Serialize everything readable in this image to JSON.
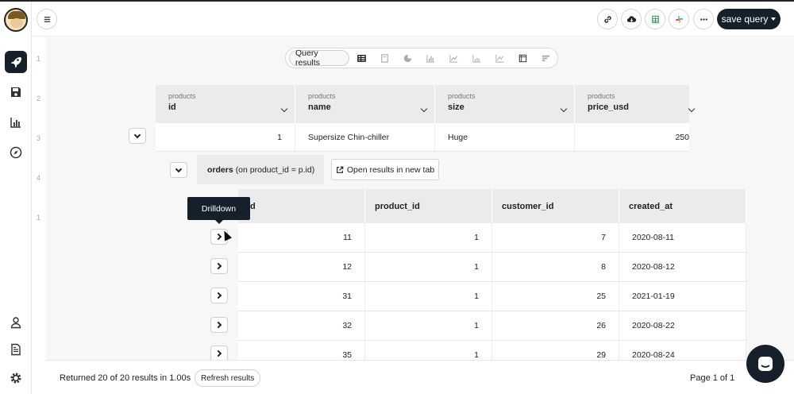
{
  "toolbar": {
    "save_label": "save query",
    "buttons": [
      "menu-icon",
      "link-icon",
      "cloud-download-icon",
      "sheets-icon",
      "slack-icon",
      "more-icon"
    ]
  },
  "sidebar": {
    "items": [
      "rocket-icon",
      "save-icon",
      "chart-icon",
      "compass-icon",
      "user-icon",
      "document-icon",
      "gear-icon"
    ],
    "ghost_numbers": [
      "1",
      "2",
      "3",
      "4",
      "1"
    ]
  },
  "viewbar": {
    "query_results_label": "Query results",
    "views": [
      "table-icon",
      "card-icon",
      "pie-icon",
      "bar-icon",
      "line-icon",
      "stacked-bar-icon",
      "area-icon",
      "pivot-icon",
      "funnel-icon"
    ]
  },
  "products": {
    "columns": [
      {
        "table": "products",
        "name": "id"
      },
      {
        "table": "products",
        "name": "name"
      },
      {
        "table": "products",
        "name": "size"
      },
      {
        "table": "products",
        "name": "price_usd"
      }
    ],
    "row": [
      "1",
      "Supersize Chin-chiller",
      "Huge",
      "250"
    ]
  },
  "orders": {
    "title": "orders",
    "condition": "(on product_id = p.id)",
    "open_label": "Open results in new tab",
    "columns": [
      "id",
      "product_id",
      "customer_id",
      "created_at"
    ],
    "rows": [
      [
        "11",
        "1",
        "7",
        "2020-08-11"
      ],
      [
        "12",
        "1",
        "8",
        "2020-08-12"
      ],
      [
        "31",
        "1",
        "25",
        "2021-01-19"
      ],
      [
        "32",
        "1",
        "26",
        "2020-08-22"
      ],
      [
        "35",
        "1",
        "29",
        "2020-08-24"
      ]
    ]
  },
  "tooltip": "Drilldown",
  "footer": {
    "returned": "Returned 20 of 20 results in 1.00s",
    "refresh": "Refresh results",
    "page": "Page 1 of 1"
  },
  "colors": {
    "dark": "#16202a",
    "header_bg": "#ebebeb",
    "content_bg": "#f7f7f7"
  }
}
